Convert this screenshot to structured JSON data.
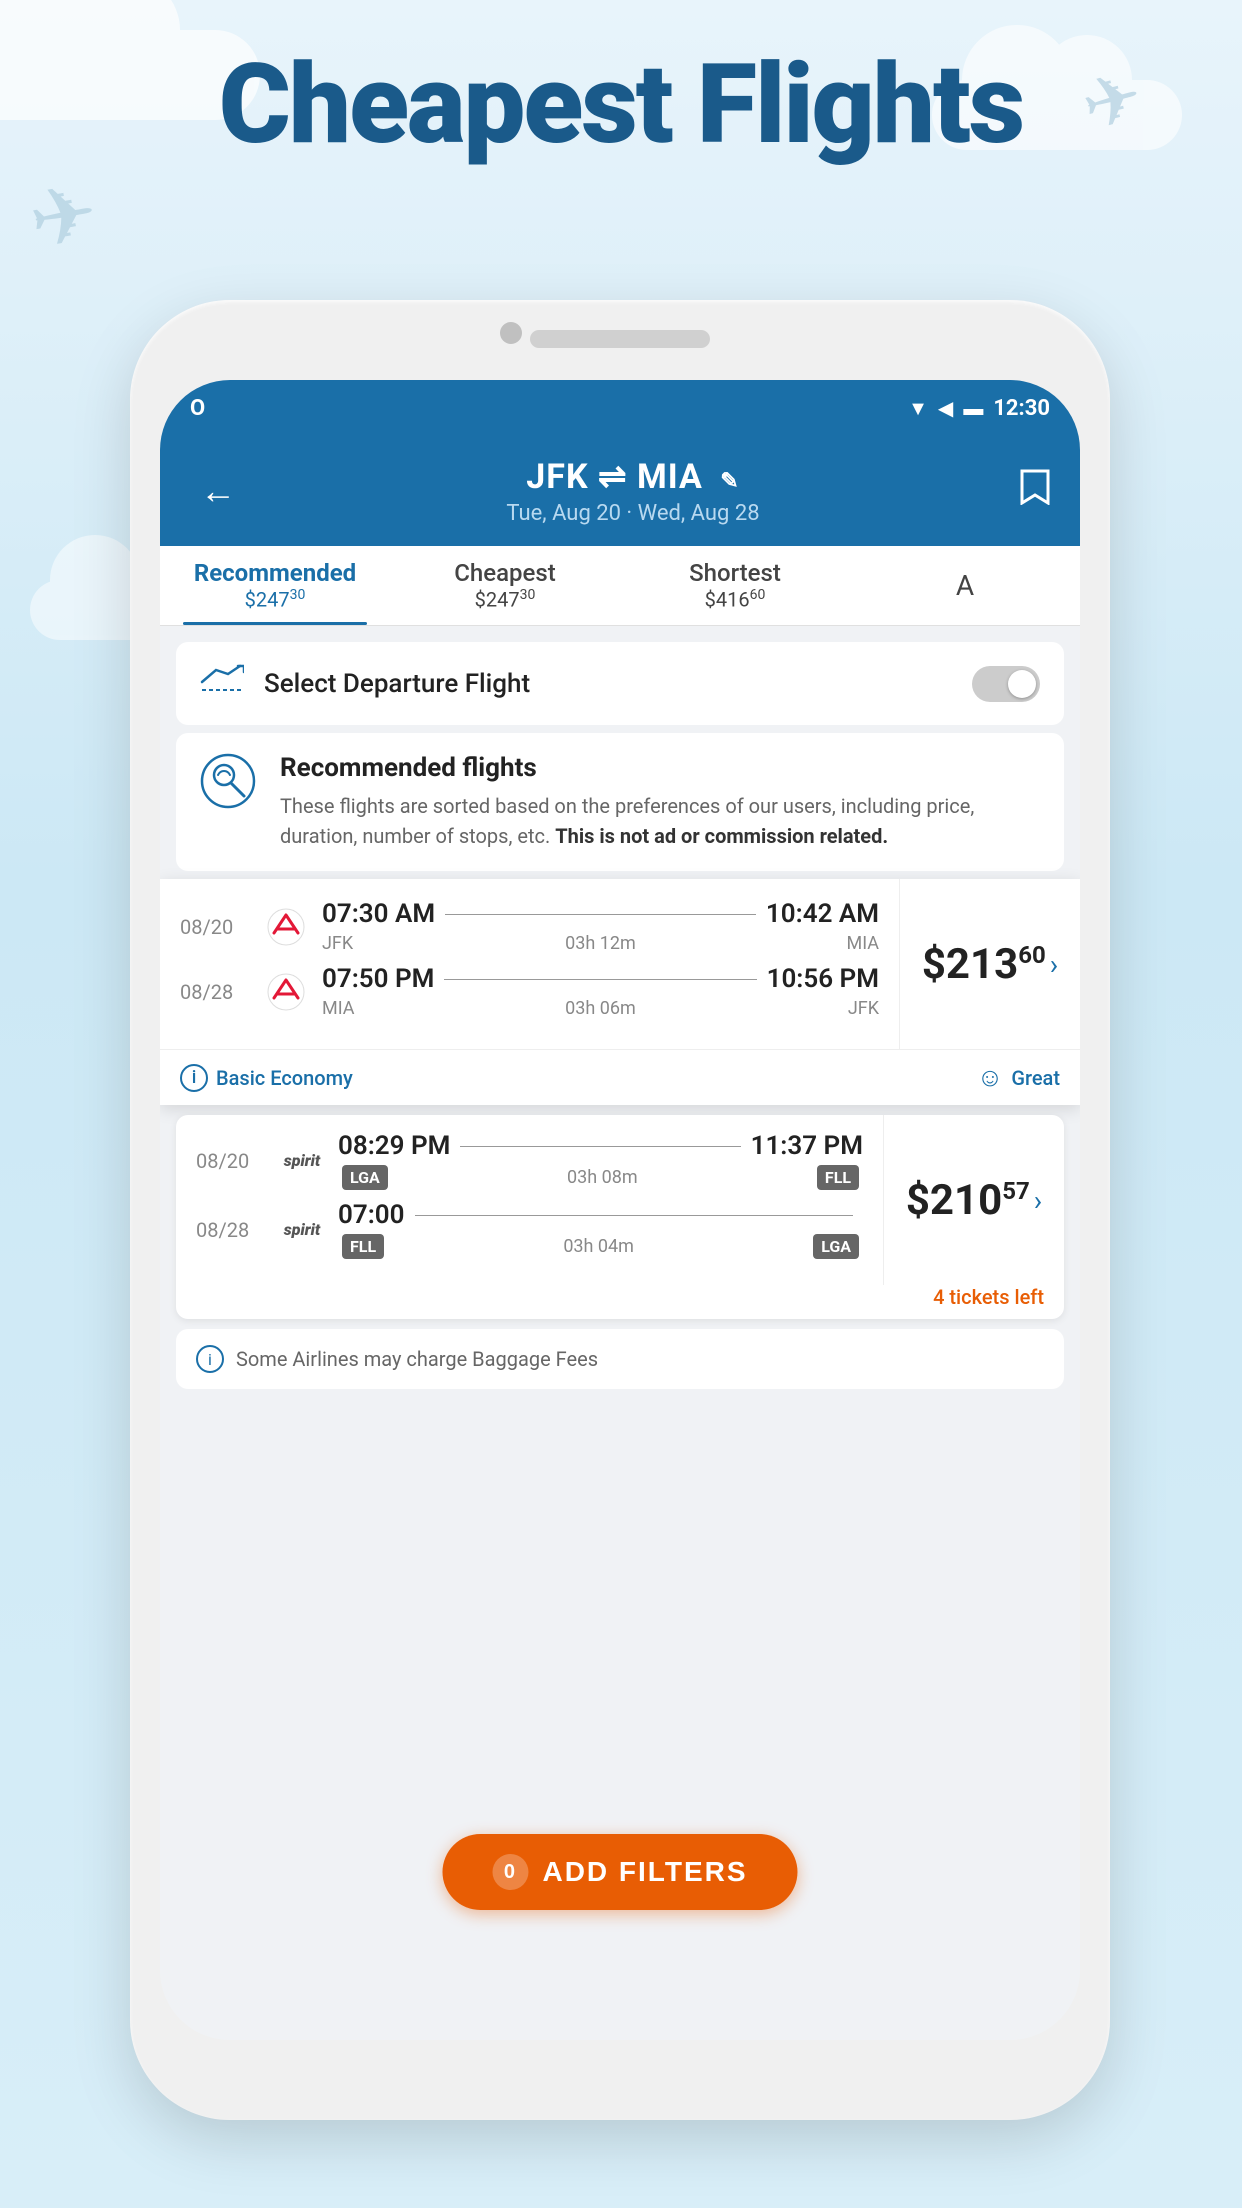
{
  "page": {
    "title": "Cheapest Flights",
    "background_color": "#d0eaf8"
  },
  "header": {
    "back_label": "←",
    "route": "JFK ⇌ MIA",
    "route_edit_icon": "✎",
    "dates": "Tue, Aug 20 · Wed, Aug 28",
    "bookmark_icon": "🔖",
    "time": "12:30"
  },
  "tabs": [
    {
      "label": "Recommended",
      "price": "$247",
      "cents": "30",
      "active": true
    },
    {
      "label": "Cheapest",
      "price": "$247",
      "cents": "30",
      "active": false
    },
    {
      "label": "Shortest",
      "price": "$416",
      "cents": "60",
      "active": false
    },
    {
      "label": "A",
      "active": false
    }
  ],
  "departure": {
    "label": "Select Departure Flight",
    "toggle_on": false
  },
  "recommended": {
    "title": "Recommended flights",
    "description": "These flights are sorted based on the preferences of our users, including price, duration, number of stops, etc.",
    "disclaimer": "This is not ad or commission related."
  },
  "flights": [
    {
      "id": "flight-1",
      "highlighted": true,
      "price": "$213",
      "price_cents": "60",
      "category": "Basic Economy",
      "rating": "Great",
      "legs": [
        {
          "date": "08/20",
          "airline": "aa",
          "depart_time": "07:30 AM",
          "arrive_time": "10:42 AM",
          "origin": "JFK",
          "duration": "03h 12m",
          "dest": "MIA"
        },
        {
          "date": "08/28",
          "airline": "aa",
          "depart_time": "07:50 PM",
          "arrive_time": "10:56 PM",
          "origin": "MIA",
          "duration": "03h 06m",
          "dest": "JFK"
        }
      ]
    },
    {
      "id": "flight-2",
      "highlighted": false,
      "price": "$210",
      "price_cents": "57",
      "tickets_left": "4 tickets left",
      "legs": [
        {
          "date": "08/20",
          "airline": "spirit",
          "depart_time": "08:29 PM",
          "arrive_time": "11:37 PM",
          "origin_tag": "LGA",
          "duration": "03h 08m",
          "dest_tag": "FLL"
        },
        {
          "date": "08/28",
          "airline": "spirit",
          "depart_time": "07:00",
          "arrive_time": "",
          "origin_tag": "FLL",
          "duration": "03h 04m",
          "dest_tag": "LGA"
        }
      ]
    }
  ],
  "baggage_notice": "Some Airlines may charge Baggage Fees",
  "add_filters": {
    "label": "ADD FILTERS",
    "count": "0"
  }
}
